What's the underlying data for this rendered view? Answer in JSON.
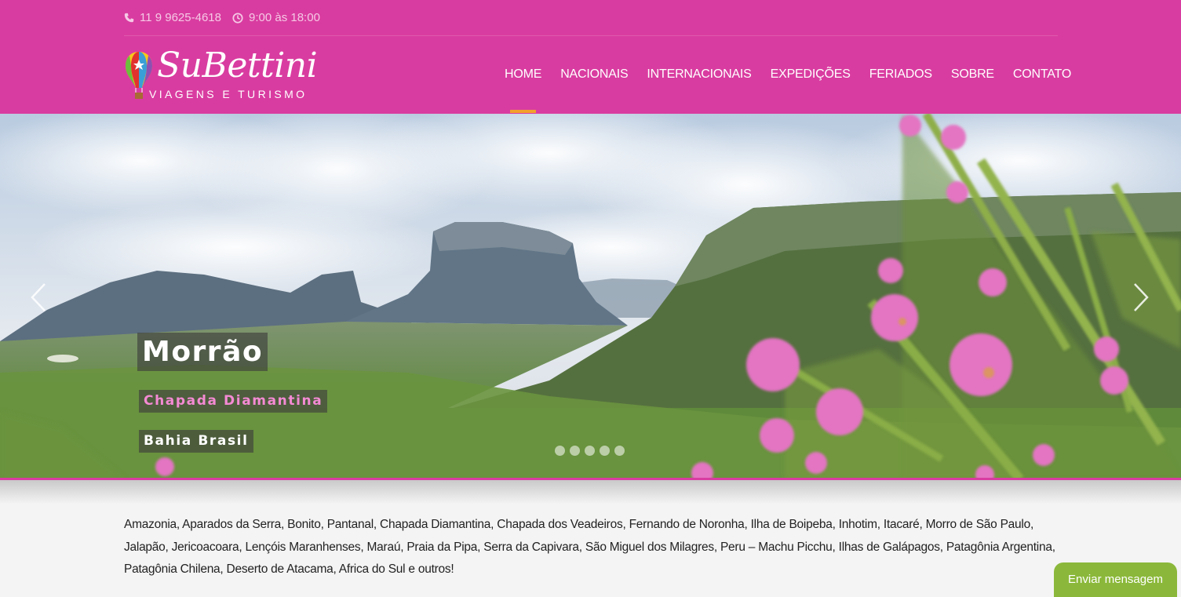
{
  "topbar": {
    "phone": "11 9 9625-4618",
    "hours": "9:00 às 18:00",
    "phone_icon": "phone-icon",
    "clock_icon": "clock-icon"
  },
  "logo": {
    "name": "SuBettini",
    "tagline": "VIAGENS E TURISMO",
    "icon": "hot-air-balloon-icon"
  },
  "nav": {
    "items": [
      "HOME",
      "NACIONAIS",
      "INTERNACIONAIS",
      "EXPEDIÇÕES",
      "FERIADOS",
      "SOBRE",
      "CONTATO"
    ],
    "active": "HOME",
    "active_color": "#f2a02c"
  },
  "slider": {
    "title": "Morrão",
    "subtitle": "Chapada Diamantina",
    "location": "Bahia Brasil",
    "prev_icon": "chevron-left-icon",
    "next_icon": "chevron-right-icon",
    "slide_count": 5
  },
  "intro": {
    "text": "Amazonia, Aparados da Serra, Bonito, Pantanal, Chapada Diamantina, Chapada dos Veadeiros, Fernando de Noronha, Ilha de Boipeba, Inhotim, Itacaré, Morro de São Paulo, Jalapão, Jericoacoara, Lençóis Maranhenses, Maraú, Praia da Pipa, Serra da Capivara, São Miguel dos Milagres, Peru – Machu Picchu, Ilhas de Galápagos, Patagônia Argentina, Patagônia Chilena, Deserto de Atacama, Africa do Sul e outros!"
  },
  "chat": {
    "label": "Enviar mensagem",
    "color": "#8bb83a"
  },
  "colors": {
    "brand": "#d93ca0",
    "caption_sub": "#f48ad4"
  }
}
